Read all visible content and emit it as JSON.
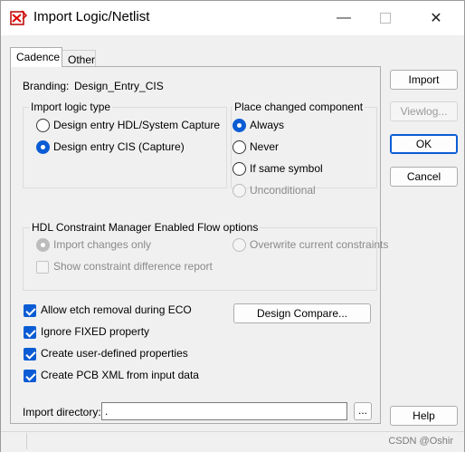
{
  "window": {
    "title": "Import Logic/Netlist",
    "app_icon": "cadence-logic-icon",
    "controls": {
      "minimize": "—",
      "maximize": "",
      "close": "✕"
    }
  },
  "tabs": [
    {
      "label": "Cadence",
      "active": true
    },
    {
      "label": "Other",
      "active": false
    }
  ],
  "branding": {
    "label": "Branding:",
    "value": "Design_Entry_CIS"
  },
  "import_logic_type": {
    "title": "Import logic type",
    "options": [
      {
        "label": "Design entry HDL/System Capture",
        "checked": false
      },
      {
        "label": "Design entry CIS (Capture)",
        "checked": true
      }
    ]
  },
  "place_changed": {
    "title": "Place changed component",
    "options": [
      {
        "label": "Always",
        "checked": true,
        "disabled": false
      },
      {
        "label": "Never",
        "checked": false,
        "disabled": false
      },
      {
        "label": "If same symbol",
        "checked": false,
        "disabled": false
      },
      {
        "label": "Unconditional",
        "checked": false,
        "disabled": true
      }
    ]
  },
  "hdl_constraint": {
    "title": "HDL Constraint Manager Enabled Flow options",
    "import_changes_only": "Import changes only",
    "overwrite_constraints": "Overwrite current constraints",
    "show_diff_report": "Show constraint difference report"
  },
  "checkboxes": [
    {
      "label": "Allow etch removal during ECO",
      "checked": true
    },
    {
      "label": "Ignore FIXED property",
      "checked": true
    },
    {
      "label": "Create user-defined properties",
      "checked": true
    },
    {
      "label": "Create PCB XML from input data",
      "checked": true
    }
  ],
  "design_compare_label": "Design Compare...",
  "import_directory": {
    "label": "Import directory:",
    "value": ".",
    "browse_label": "..."
  },
  "side_buttons": {
    "import": "Import",
    "viewlog": "Viewlog...",
    "ok": "OK",
    "cancel": "Cancel",
    "help": "Help"
  },
  "watermark": "CSDN @Oshir",
  "colors": {
    "accent": "#0b5cd4",
    "background": "#f0f0f0"
  }
}
